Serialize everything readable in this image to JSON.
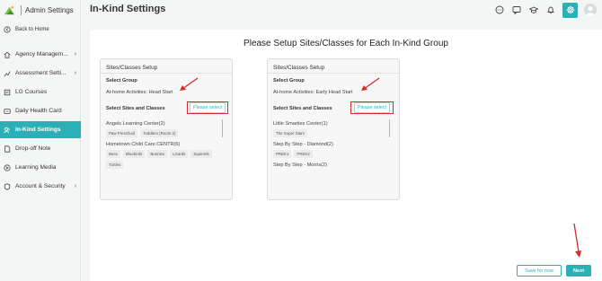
{
  "app": {
    "title": "Admin Settings"
  },
  "sidebar": {
    "back": "Back to Home",
    "items": [
      {
        "label": "Agency Managem...",
        "icon": "home-icon",
        "chevron": true
      },
      {
        "label": "Assessment Setti...",
        "icon": "chart-icon",
        "chevron": true
      },
      {
        "label": "LG Courses",
        "icon": "book-icon",
        "chevron": false
      },
      {
        "label": "Daily Health Card",
        "icon": "card-icon",
        "chevron": false
      },
      {
        "label": "In-Kind Settings",
        "icon": "people-icon",
        "chevron": false,
        "active": true
      },
      {
        "label": "Drop-off Note",
        "icon": "note-icon",
        "chevron": false
      },
      {
        "label": "Learning Media",
        "icon": "media-icon",
        "chevron": false
      },
      {
        "label": "Account & Security",
        "icon": "shield-icon",
        "chevron": true
      }
    ]
  },
  "header": {
    "title": "In-Kind Settings"
  },
  "main": {
    "heading": "Please Setup Sites/Classes for Each In-Kind Group",
    "cards": [
      {
        "title": "Sites/Classes Setup",
        "group_label": "Select Group",
        "group_value": "At-home Activities: Head Start",
        "sites_label": "Select Sites and Classes",
        "select_button": "Please select",
        "sites": [
          {
            "name": "Angels Learning Center(2)",
            "classes": [
              "Paw Preschool",
              "Toddlers (Room 2)"
            ]
          },
          {
            "name": "Hometown Child Care CENTR(6)",
            "classes": [
              "Bees",
              "Bluebirds",
              "Bunnies",
              "Lizards",
              "Squirrels",
              "Turtles"
            ]
          }
        ]
      },
      {
        "title": "Sites/Classes Setup",
        "group_label": "Select Group",
        "group_value": "At-home Activities: Early Head Start",
        "sites_label": "Select Sites and Classes",
        "select_button": "Please select",
        "sites": [
          {
            "name": "Little Smarties Center(1)",
            "classes": [
              "The Super Stars"
            ]
          },
          {
            "name": "Step By Step - Diamond(2)",
            "classes": [
              "PREK1",
              "PREK2"
            ]
          },
          {
            "name": "Step By Step - Morris(2)",
            "classes": []
          }
        ]
      }
    ],
    "save_button": "Save for now",
    "next_button": "Next"
  },
  "colors": {
    "accent": "#2bb1b5",
    "highlight": "#d62b2b"
  }
}
